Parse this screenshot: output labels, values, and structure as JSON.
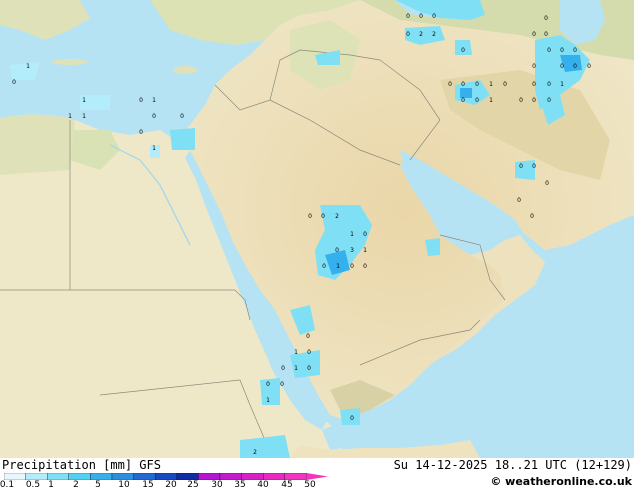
{
  "map": {
    "regions": "Middle East / Arabian Peninsula",
    "sea_color": "#b6e3f3",
    "land_color": "#efe5c4",
    "precip_light_color": "#7fe0f5",
    "precip_mid_color": "#36b0ec"
  },
  "point_labels": [
    {
      "id": "p1",
      "text": "0"
    },
    {
      "id": "p2",
      "text": "0"
    },
    {
      "id": "p3",
      "text": "0"
    },
    {
      "id": "p4",
      "text": "0"
    },
    {
      "id": "p5",
      "text": "2"
    },
    {
      "id": "p6",
      "text": "2"
    },
    {
      "id": "p7",
      "text": "0"
    },
    {
      "id": "p8",
      "text": "0"
    },
    {
      "id": "p9",
      "text": "0"
    },
    {
      "id": "p10",
      "text": "0"
    },
    {
      "id": "p11",
      "text": "0"
    },
    {
      "id": "p12",
      "text": "0"
    },
    {
      "id": "p13",
      "text": "0"
    },
    {
      "id": "p14",
      "text": "0"
    },
    {
      "id": "p15",
      "text": "0"
    },
    {
      "id": "p16",
      "text": "0"
    },
    {
      "id": "p17",
      "text": "0"
    },
    {
      "id": "p18",
      "text": "0"
    },
    {
      "id": "p19",
      "text": "0"
    },
    {
      "id": "p20",
      "text": "0"
    },
    {
      "id": "p21",
      "text": "0"
    },
    {
      "id": "p22",
      "text": "1"
    },
    {
      "id": "p23",
      "text": "0"
    },
    {
      "id": "p24",
      "text": "0"
    },
    {
      "id": "p25",
      "text": "1"
    },
    {
      "id": "p26",
      "text": "0"
    },
    {
      "id": "p27",
      "text": "0"
    },
    {
      "id": "p28",
      "text": "1"
    },
    {
      "id": "p29",
      "text": "0"
    },
    {
      "id": "p30",
      "text": "0"
    },
    {
      "id": "p31",
      "text": "0"
    },
    {
      "id": "p32",
      "text": "1"
    },
    {
      "id": "p33",
      "text": "0"
    },
    {
      "id": "p34",
      "text": "1"
    },
    {
      "id": "p35",
      "text": "0"
    },
    {
      "id": "p36",
      "text": "1"
    },
    {
      "id": "p37",
      "text": "1"
    },
    {
      "id": "p38",
      "text": "1"
    },
    {
      "id": "p39",
      "text": "0"
    },
    {
      "id": "p40",
      "text": "0"
    },
    {
      "id": "p41",
      "text": "0"
    },
    {
      "id": "p42",
      "text": "1"
    },
    {
      "id": "p43",
      "text": "0"
    },
    {
      "id": "p44",
      "text": "0"
    },
    {
      "id": "p45",
      "text": "0"
    },
    {
      "id": "p46",
      "text": "0"
    },
    {
      "id": "p47",
      "text": "0"
    },
    {
      "id": "p48",
      "text": "0"
    },
    {
      "id": "p49",
      "text": "0"
    },
    {
      "id": "p50",
      "text": "2"
    },
    {
      "id": "p51",
      "text": "1"
    },
    {
      "id": "p52",
      "text": "0"
    },
    {
      "id": "p53",
      "text": "0"
    },
    {
      "id": "p54",
      "text": "3"
    },
    {
      "id": "p55",
      "text": "1"
    },
    {
      "id": "p56",
      "text": "0"
    },
    {
      "id": "p57",
      "text": "1"
    },
    {
      "id": "p58",
      "text": "0"
    },
    {
      "id": "p59",
      "text": "0"
    },
    {
      "id": "p60",
      "text": "0"
    },
    {
      "id": "p61",
      "text": "1"
    },
    {
      "id": "p62",
      "text": "0"
    },
    {
      "id": "p63",
      "text": "0"
    },
    {
      "id": "p64",
      "text": "1"
    },
    {
      "id": "p65",
      "text": "0"
    },
    {
      "id": "p66",
      "text": "0"
    },
    {
      "id": "p67",
      "text": "0"
    },
    {
      "id": "p68",
      "text": "1"
    },
    {
      "id": "p69",
      "text": "2"
    },
    {
      "id": "p70",
      "text": "0"
    }
  ],
  "footer": {
    "title": "Precipitation [mm]  GFS",
    "datetime": "Su 14-12-2025 18..21 UTC (12+129)",
    "brand": "© weatheronline.co.uk"
  },
  "legend": {
    "labels": [
      "0.1",
      "0.5",
      "1",
      "2",
      "5",
      "10",
      "15",
      "20",
      "25",
      "30",
      "35",
      "40",
      "45",
      "50"
    ],
    "colors": [
      "#e6f7fd",
      "#b3ecfb",
      "#7fe0f5",
      "#4fd2f2",
      "#36b0ec",
      "#2a8fe0",
      "#1f6ad4",
      "#1848c4",
      "#0e2ba8",
      "#b214d8",
      "#c61ad0",
      "#d620c8",
      "#e62ac2",
      "#f235bf"
    ]
  }
}
